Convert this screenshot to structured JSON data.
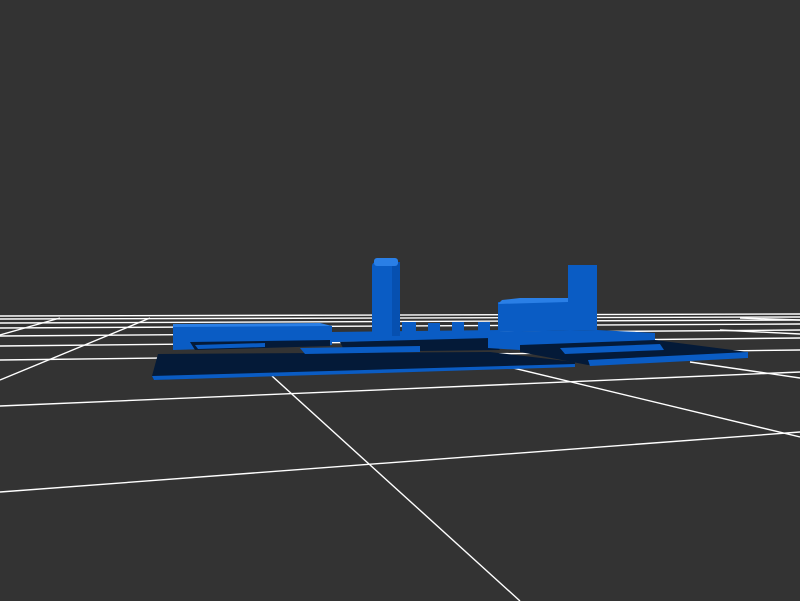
{
  "scene": {
    "background_color": "#333333",
    "grid_color": "#ffffff",
    "model_color": "#0a5cc4",
    "model_dark_color": "#041a38",
    "model_light_color": "#2a7fe6"
  }
}
